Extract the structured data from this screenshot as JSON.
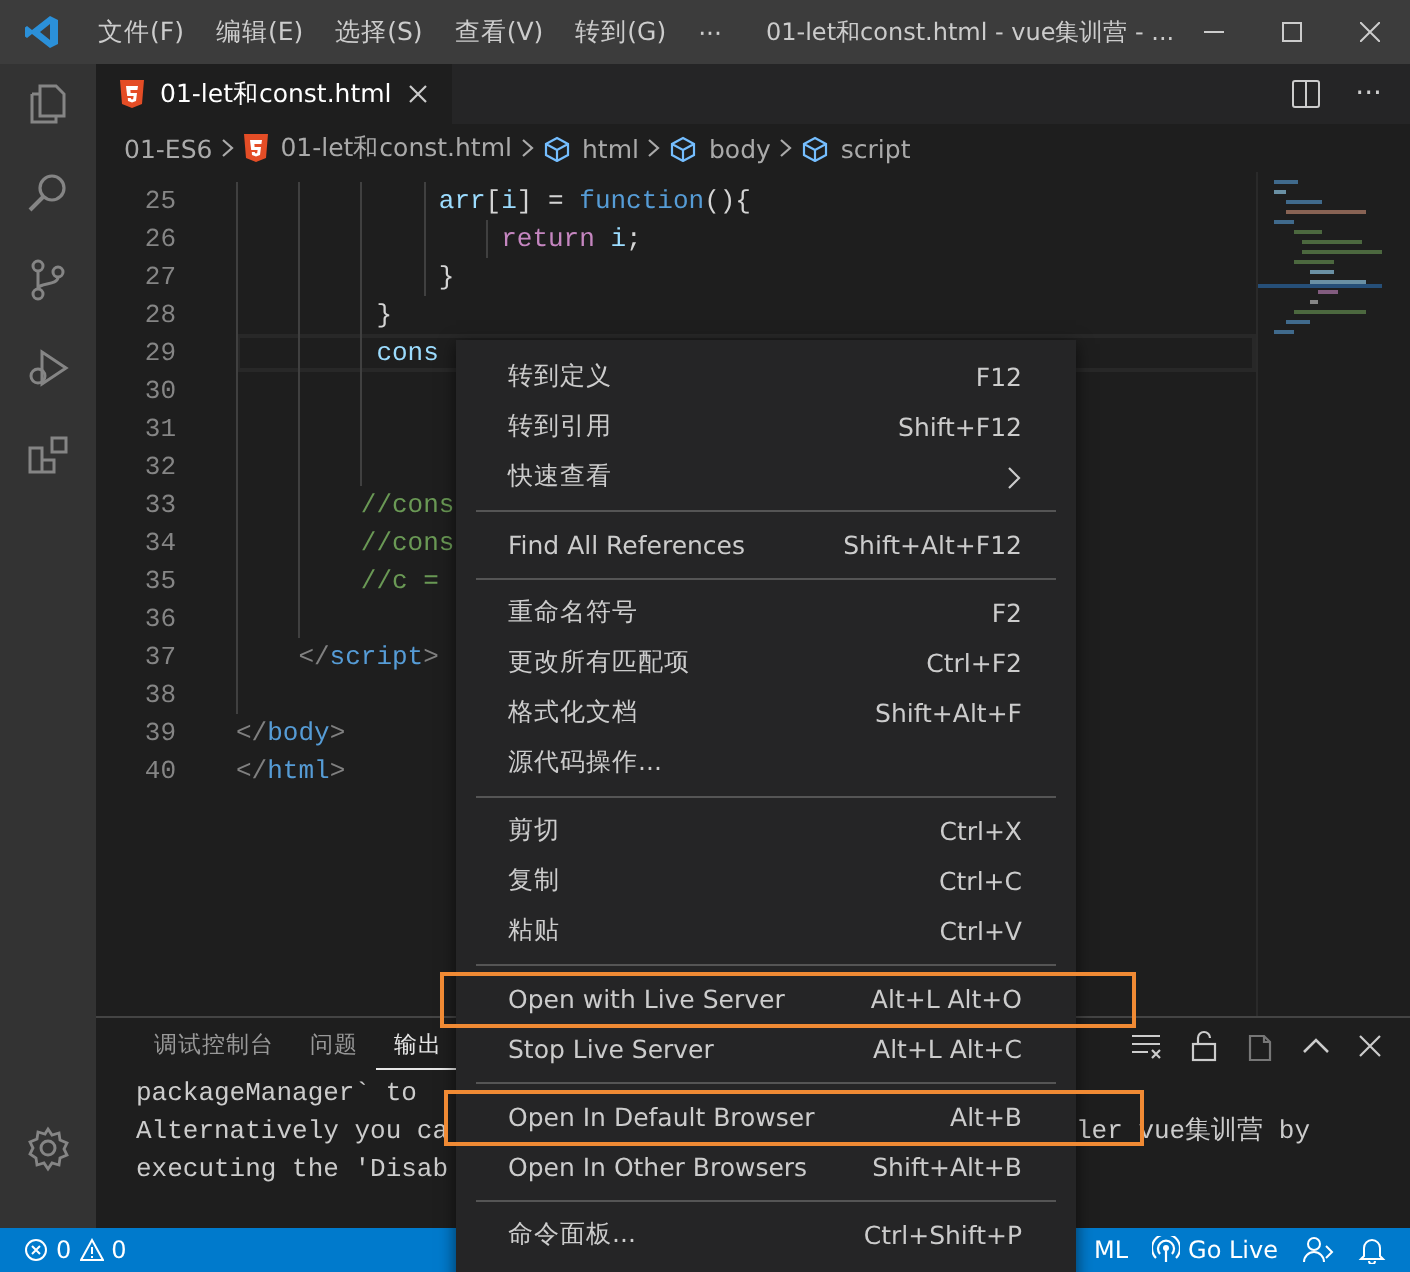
{
  "title_bar": {
    "menus": [
      "文件(F)",
      "编辑(E)",
      "选择(S)",
      "查看(V)",
      "转到(G)"
    ],
    "more": "···",
    "title": "01-let和const.html - vue集训营 - ..."
  },
  "tabs": [
    {
      "label": "01-let和const.html",
      "selected": true
    }
  ],
  "editor_actions": {
    "more": "···"
  },
  "breadcrumbs": [
    {
      "label": "01-ES6",
      "kind": "folder"
    },
    {
      "label": "01-let和const.html",
      "kind": "file"
    },
    {
      "label": "html",
      "kind": "symbol"
    },
    {
      "label": "body",
      "kind": "symbol"
    },
    {
      "label": "script",
      "kind": "symbol"
    }
  ],
  "editor": {
    "lines": [
      {
        "number": "25",
        "tokens": [
          {
            "kind": "variable",
            "text": "             arr"
          },
          {
            "kind": "punct",
            "text": "["
          },
          {
            "kind": "variable",
            "text": "i"
          },
          {
            "kind": "punct",
            "text": "] = "
          },
          {
            "kind": "storage",
            "text": "function"
          },
          {
            "kind": "punct",
            "text": "(){"
          }
        ]
      },
      {
        "number": "26",
        "tokens": [
          {
            "kind": "control",
            "text": "                 return "
          },
          {
            "kind": "variable",
            "text": "i"
          },
          {
            "kind": "punct",
            "text": ";"
          }
        ]
      },
      {
        "number": "27",
        "tokens": [
          {
            "kind": "punct",
            "text": "             }"
          }
        ]
      },
      {
        "number": "28",
        "tokens": [
          {
            "kind": "punct",
            "text": "         }"
          }
        ]
      },
      {
        "number": "29",
        "current": true,
        "tokens": [
          {
            "kind": "variable",
            "text": "         cons"
          }
        ]
      },
      {
        "number": "30"
      },
      {
        "number": "31"
      },
      {
        "number": "32"
      },
      {
        "number": "33",
        "tokens": [
          {
            "kind": "comment",
            "text": "        //cons"
          }
        ]
      },
      {
        "number": "34",
        "tokens": [
          {
            "kind": "comment",
            "text": "        //cons"
          }
        ]
      },
      {
        "number": "35",
        "tokens": [
          {
            "kind": "comment",
            "text": "        //c ="
          }
        ]
      },
      {
        "number": "36"
      },
      {
        "number": "37",
        "tokens": [
          {
            "kind": "bracket",
            "text": "    </"
          },
          {
            "kind": "tag",
            "text": "script"
          },
          {
            "kind": "bracket",
            "text": ">"
          }
        ]
      },
      {
        "number": "38"
      },
      {
        "number": "39",
        "tokens": [
          {
            "kind": "bracket",
            "text": "</"
          },
          {
            "kind": "tag",
            "text": "body"
          },
          {
            "kind": "bracket",
            "text": ">"
          }
        ]
      },
      {
        "number": "40",
        "tokens": [
          {
            "kind": "bracket",
            "text": "</"
          },
          {
            "kind": "tag",
            "text": "html"
          },
          {
            "kind": "bracket",
            "text": ">"
          }
        ]
      }
    ]
  },
  "panel": {
    "tabs": [
      {
        "label": "调试控制台",
        "selected": false
      },
      {
        "label": "问题",
        "selected": false
      },
      {
        "label": "输出",
        "selected": true
      }
    ],
    "output": [
      {
        "left": "packageManager` to"
      },
      {
        "left": "Alternatively you ca",
        "right": "ler vue集训营 by"
      },
      {
        "left": "executing the 'Disab"
      }
    ]
  },
  "status_bar": {
    "errors": "0",
    "warnings": "0",
    "language": "ML",
    "live": "Go Live"
  },
  "context_menu": {
    "groups": [
      [
        {
          "label": "转到定义",
          "shortcut": "F12",
          "kind": "item",
          "annotated": false
        },
        {
          "label": "转到引用",
          "shortcut": "Shift+F12",
          "kind": "item",
          "annotated": false
        },
        {
          "label": "快速查看",
          "kind": "submenu",
          "annotated": false
        }
      ],
      [
        {
          "label": "Find All References",
          "shortcut": "Shift+Alt+F12",
          "kind": "item",
          "annotated": false
        }
      ],
      [
        {
          "label": "重命名符号",
          "shortcut": "F2",
          "kind": "item",
          "annotated": false
        },
        {
          "label": "更改所有匹配项",
          "shortcut": "Ctrl+F2",
          "kind": "item",
          "annotated": false
        },
        {
          "label": "格式化文档",
          "shortcut": "Shift+Alt+F",
          "kind": "item",
          "annotated": false
        },
        {
          "label": "源代码操作...",
          "kind": "item",
          "annotated": false
        }
      ],
      [
        {
          "label": "剪切",
          "shortcut": "Ctrl+X",
          "kind": "item",
          "annotated": false
        },
        {
          "label": "复制",
          "shortcut": "Ctrl+C",
          "kind": "item",
          "annotated": false
        },
        {
          "label": "粘贴",
          "shortcut": "Ctrl+V",
          "kind": "item",
          "annotated": false
        }
      ],
      [
        {
          "label": "Open with Live Server",
          "shortcut": "Alt+L Alt+O",
          "kind": "item",
          "annotated": true
        },
        {
          "label": "Stop Live Server",
          "shortcut": "Alt+L Alt+C",
          "kind": "item",
          "annotated": false
        }
      ],
      [
        {
          "label": "Open In Default Browser",
          "shortcut": "Alt+B",
          "kind": "item",
          "annotated": true
        },
        {
          "label": "Open In Other Browsers",
          "shortcut": "Shift+Alt+B",
          "kind": "item",
          "annotated": false
        }
      ],
      [
        {
          "label": "命令面板...",
          "shortcut": "Ctrl+Shift+P",
          "kind": "item",
          "annotated": false
        }
      ]
    ]
  }
}
